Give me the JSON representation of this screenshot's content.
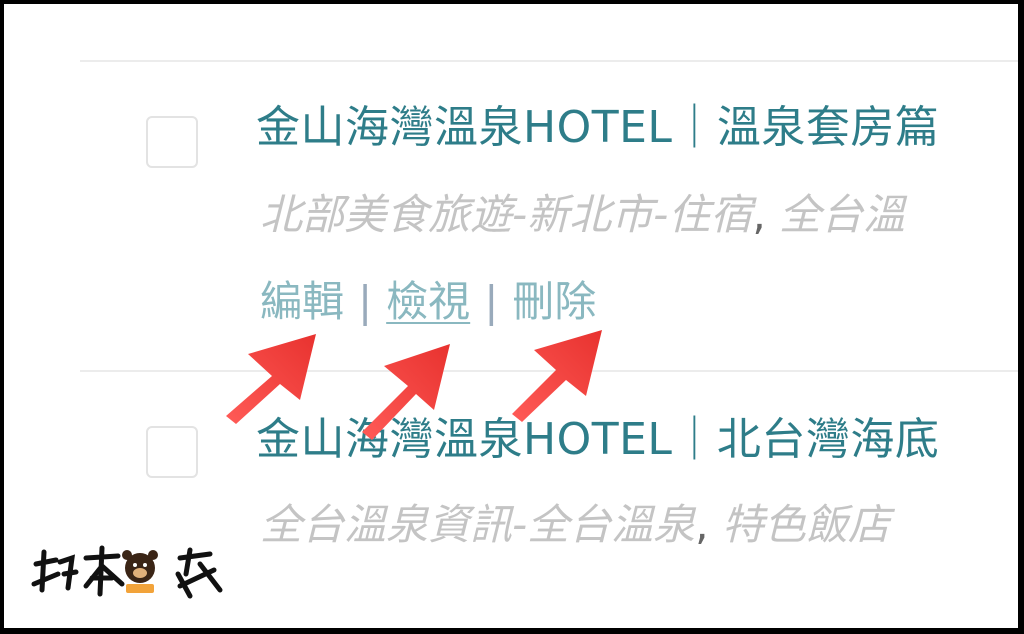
{
  "posts": [
    {
      "title": "金山海灣溫泉HOTEL｜溫泉套房篇",
      "categories": "北部美食旅遊-新北市-住宿",
      "categories_more": "全台溫",
      "actions": {
        "edit": "編輯",
        "view": "檢視",
        "delete": "刪除"
      }
    },
    {
      "title": "金山海灣溫泉HOTEL｜北台灣海底",
      "categories": "全台溫泉資訊-全台溫泉",
      "categories_more": "特色飯店"
    }
  ],
  "action_separator": "|",
  "category_separator": ",",
  "watermark": {
    "text": "貓本貓家",
    "icon": "bear-mascot-icon"
  },
  "colors": {
    "title": "#2e7d89",
    "category": "#c4c4c4",
    "action_link": "#8ab8c0",
    "arrow": "#f0413f",
    "divider": "#ececec"
  }
}
